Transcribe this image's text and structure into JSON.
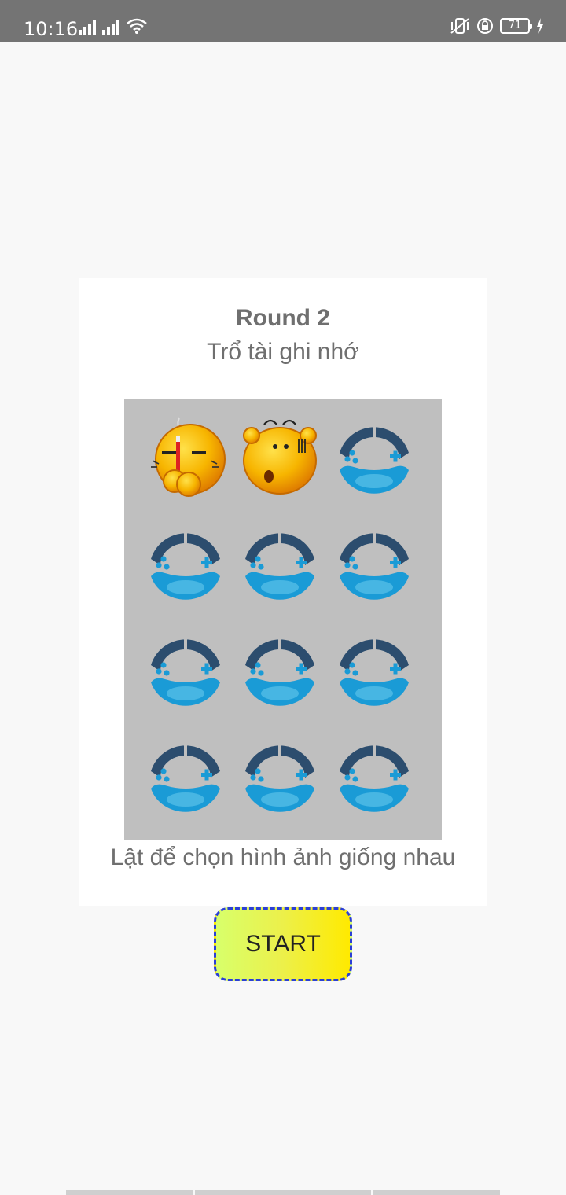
{
  "status_bar": {
    "time": "10:16",
    "battery_level": "71"
  },
  "game": {
    "round_title": "Round 2",
    "subtitle": "Trổ tài ghi nhớ",
    "hint": "Lật để chọn hình ảnh giống nhau",
    "start_label": "START",
    "tiles": [
      {
        "state": "revealed",
        "icon": "smoking-emoji-icon"
      },
      {
        "state": "revealed",
        "icon": "surprised-emoji-icon"
      },
      {
        "state": "hidden",
        "icon": "gamepad-icon"
      },
      {
        "state": "hidden",
        "icon": "gamepad-icon"
      },
      {
        "state": "hidden",
        "icon": "gamepad-icon"
      },
      {
        "state": "hidden",
        "icon": "gamepad-icon"
      },
      {
        "state": "hidden",
        "icon": "gamepad-icon"
      },
      {
        "state": "hidden",
        "icon": "gamepad-icon"
      },
      {
        "state": "hidden",
        "icon": "gamepad-icon"
      },
      {
        "state": "hidden",
        "icon": "gamepad-icon"
      },
      {
        "state": "hidden",
        "icon": "gamepad-icon"
      },
      {
        "state": "hidden",
        "icon": "gamepad-icon"
      }
    ]
  },
  "colors": {
    "status_bar": "#747474",
    "page_background": "#f8f8f8",
    "board_background": "#bfbfbf",
    "text": "#6f6f6f",
    "button_border": "#2a3fd6",
    "button_gradient_start": "#d8ff6b",
    "button_gradient_end": "#ffea00"
  }
}
